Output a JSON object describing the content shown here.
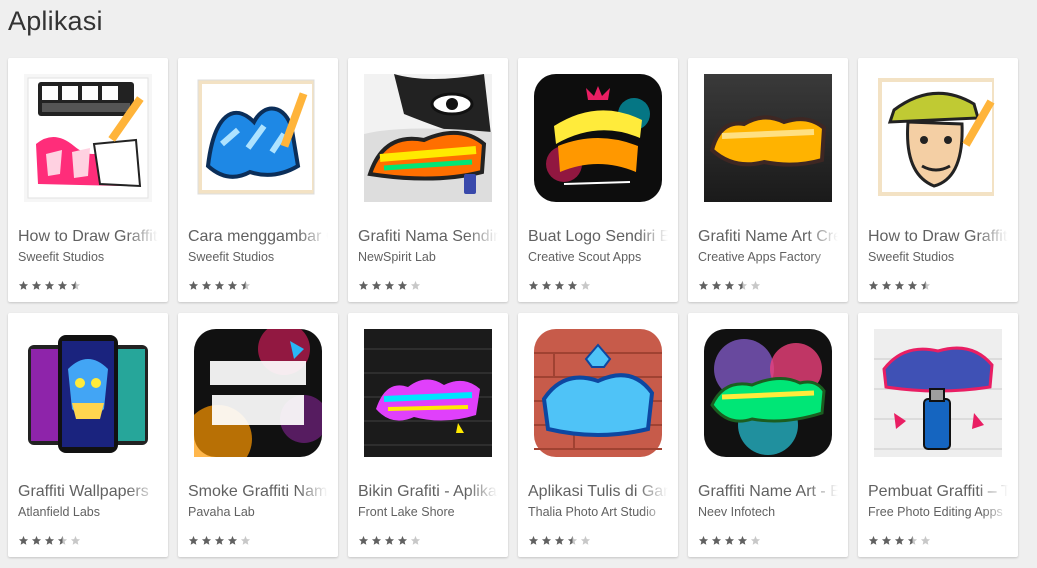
{
  "section": {
    "title": "Aplikasi"
  },
  "colors": {
    "star_filled": "#616161",
    "star_empty": "#c8c8c8"
  },
  "apps": [
    {
      "title": "How to Draw Graffiti Name",
      "developer": "Sweefit Studios",
      "rating": 4.5,
      "icon": "name-graffiti-pencil-icon"
    },
    {
      "title": "Cara menggambar Grafiti",
      "developer": "Sweefit Studios",
      "rating": 4.5,
      "icon": "graffiti-drawing-pencil-icon"
    },
    {
      "title": "Grafiti Nama Sendiri",
      "developer": "NewSpirit Lab",
      "rating": 4.0,
      "icon": "graffiti-face-icon"
    },
    {
      "title": "Buat Logo Sendiri Editor",
      "developer": "Creative Scout Apps",
      "rating": 4.0,
      "icon": "graffiti-maker-icon"
    },
    {
      "title": "Grafiti Name Art Creator",
      "developer": "Creative Apps Factory",
      "rating": 3.5,
      "icon": "graffiti-gold-text-icon"
    },
    {
      "title": "How to Draw Graffiti Characters",
      "developer": "Sweefit Studios",
      "rating": 4.5,
      "icon": "graffiti-character-icon"
    },
    {
      "title": "Graffiti Wallpapers",
      "developer": "Atlanfield Labs",
      "rating": 3.5,
      "icon": "graffiti-wallpaper-phones-icon"
    },
    {
      "title": "Smoke Graffiti Name Art",
      "developer": "Pavaha Lab",
      "rating": 4.0,
      "icon": "smoke-graffiti-name-icon"
    },
    {
      "title": "Bikin Grafiti - Aplikasi",
      "developer": "Front Lake Shore",
      "rating": 4.0,
      "icon": "neon-graffiti-icon"
    },
    {
      "title": "Aplikasi Tulis di Gambar",
      "developer": "Thalia Photo Art Studio",
      "rating": 3.5,
      "icon": "graffiti-text-brick-icon"
    },
    {
      "title": "Graffiti Name Art - Editor",
      "developer": "Neev Infotech",
      "rating": 4.0,
      "icon": "graffiti-smoke-colorful-icon"
    },
    {
      "title": "Pembuat Graffiti – Teks",
      "developer": "Free Photo Editing Apps",
      "rating": 3.5,
      "icon": "graffiti-text-on-photo-icon"
    }
  ]
}
